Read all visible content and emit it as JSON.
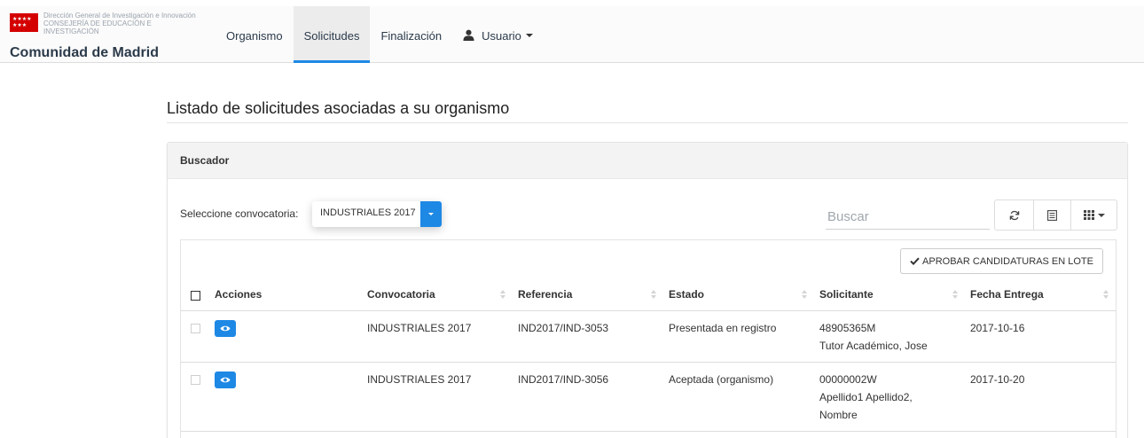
{
  "colors": {
    "accent": "#1e88e5",
    "brand_red": "#d40000",
    "navbar_bg": "#fbfbfb"
  },
  "brand": {
    "flag_stars": "★★★★\n★★★",
    "line1": "Dirección General de Investigación e Innovación",
    "line2": "CONSEJERÍA DE EDUCACIÓN E",
    "line3": "INVESTIGACIÓN",
    "title": "Comunidad de Madrid"
  },
  "nav": {
    "items": [
      {
        "label": "Organismo",
        "active": false
      },
      {
        "label": "Solicitudes",
        "active": true
      },
      {
        "label": "Finalización",
        "active": false
      }
    ],
    "user_label": "Usuario",
    "user_icon": "user-icon"
  },
  "page": {
    "title": "Listado de solicitudes asociadas a su organismo"
  },
  "buscador": {
    "heading": "Buscador",
    "select_label": "Seleccione convocatoria:",
    "select_value": "INDUSTRIALES 2017",
    "search_placeholder": "Buscar",
    "toolbar_icons": [
      "refresh-icon",
      "list-view-icon",
      "columns-icon"
    ]
  },
  "table": {
    "lote_button": "APROBAR CANDIDATURAS EN LOTE",
    "columns": [
      "Acciones",
      "Convocatoria",
      "Referencia",
      "Estado",
      "Solicitante",
      "Fecha Entrega"
    ],
    "rows": [
      {
        "convocatoria": "INDUSTRIALES 2017",
        "referencia": "IND2017/IND-3053",
        "estado": "Presentada en registro",
        "solicitante_id": "48905365M",
        "solicitante_nombre": "Tutor Académico, Jose",
        "solicitante_nombre2": "",
        "fecha": "2017-10-16"
      },
      {
        "convocatoria": "INDUSTRIALES 2017",
        "referencia": "IND2017/IND-3056",
        "estado": "Aceptada (organismo)",
        "solicitante_id": "00000002W",
        "solicitante_nombre": "Apellido1 Apellido2,",
        "solicitante_nombre2": "Nombre",
        "fecha": "2017-10-20"
      }
    ]
  }
}
